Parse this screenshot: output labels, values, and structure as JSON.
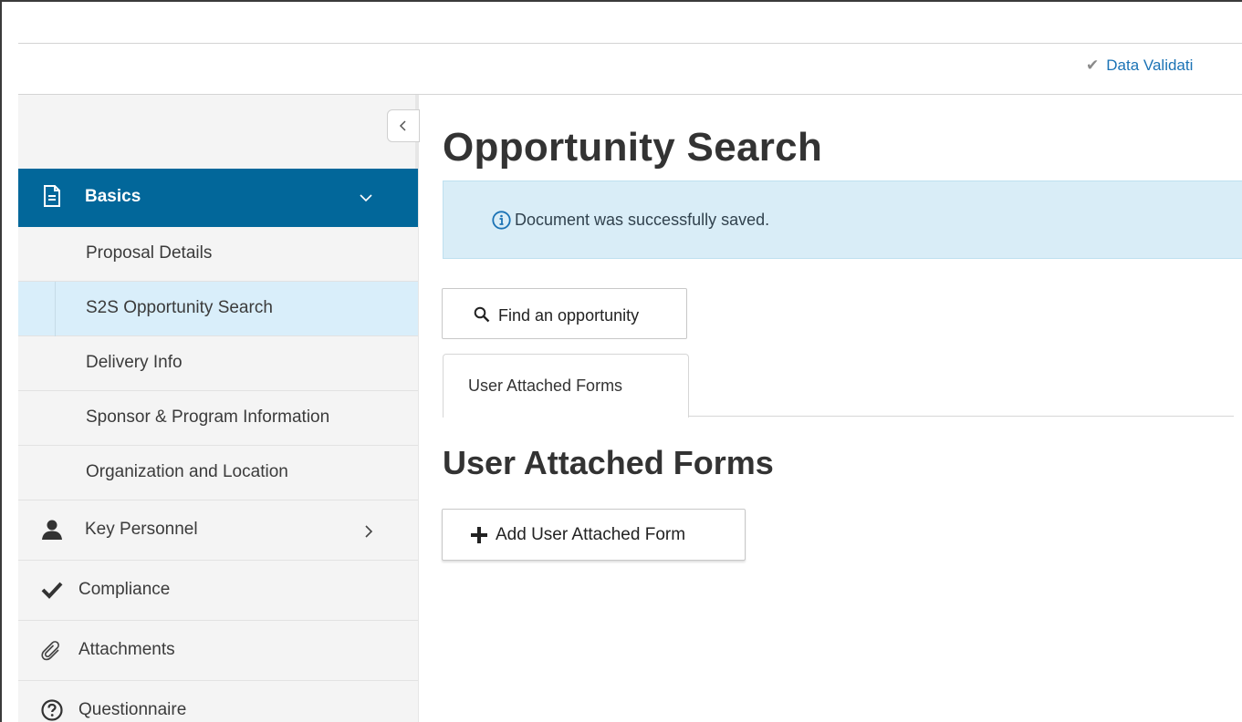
{
  "header": {
    "data_validation_label": "Data Validati"
  },
  "page": {
    "title": "Opportunity Search"
  },
  "alert": {
    "message": "Document was successfully saved."
  },
  "sidebar": {
    "basics_label": "Basics",
    "sub_items": [
      {
        "label": "Proposal Details",
        "active": false
      },
      {
        "label": "S2S Opportunity Search",
        "active": true
      },
      {
        "label": "Delivery Info",
        "active": false
      },
      {
        "label": "Sponsor & Program Information",
        "active": false
      },
      {
        "label": "Organization and Location",
        "active": false
      }
    ],
    "items": [
      {
        "label": "Key Personnel",
        "icon": "person-icon"
      },
      {
        "label": "Compliance",
        "icon": "checkmark-icon"
      },
      {
        "label": "Attachments",
        "icon": "paperclip-icon"
      },
      {
        "label": "Questionnaire",
        "icon": "question-circle-icon"
      }
    ]
  },
  "main": {
    "find_button_label": "Find an opportunity",
    "tab_label": "User Attached Forms",
    "section_title": "User Attached Forms",
    "add_button_label": "Add User Attached Form"
  },
  "colors": {
    "accent": "#02679a",
    "active_item_bg": "#d9eefa",
    "alert_bg": "#d9edf7",
    "link": "#1b73b5"
  }
}
